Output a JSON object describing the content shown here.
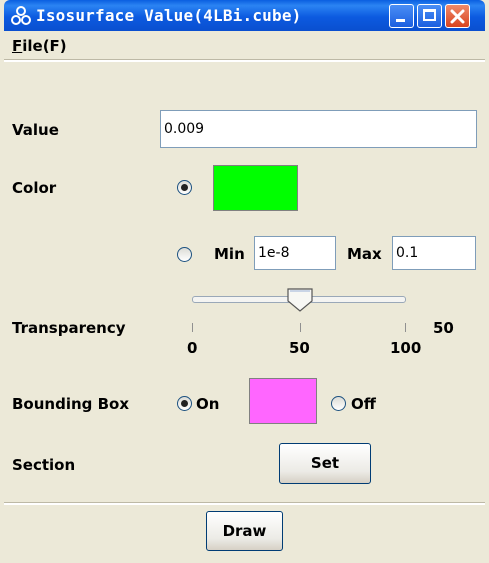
{
  "window": {
    "title": "Isosurface Value(4LBi.cube)",
    "app_icon": "molecule-icon",
    "buttons": {
      "minimize": "minimize-icon",
      "maximize": "maximize-icon",
      "close": "close-icon"
    }
  },
  "menu": {
    "file_label": "File(F)"
  },
  "form": {
    "value_label": "Value",
    "value": "0.009",
    "color_label": "Color",
    "color_fixed_selected": true,
    "color_fixed": "#00ff00",
    "min_label": "Min",
    "min_value": "1e-8",
    "max_label": "Max",
    "max_value": "0.1",
    "transparency_label": "Transparency",
    "transparency_value": "50",
    "slider": {
      "min": 0,
      "max": 100,
      "value": 50,
      "tick_labels": [
        "0",
        "50",
        "100"
      ]
    },
    "bounding_box_label": "Bounding Box",
    "bbox_on_label": "On",
    "bbox_on_selected": true,
    "bbox_color": "#ff66ff",
    "bbox_off_label": "Off",
    "section_label": "Section",
    "set_button": "Set",
    "draw_button": "Draw"
  }
}
